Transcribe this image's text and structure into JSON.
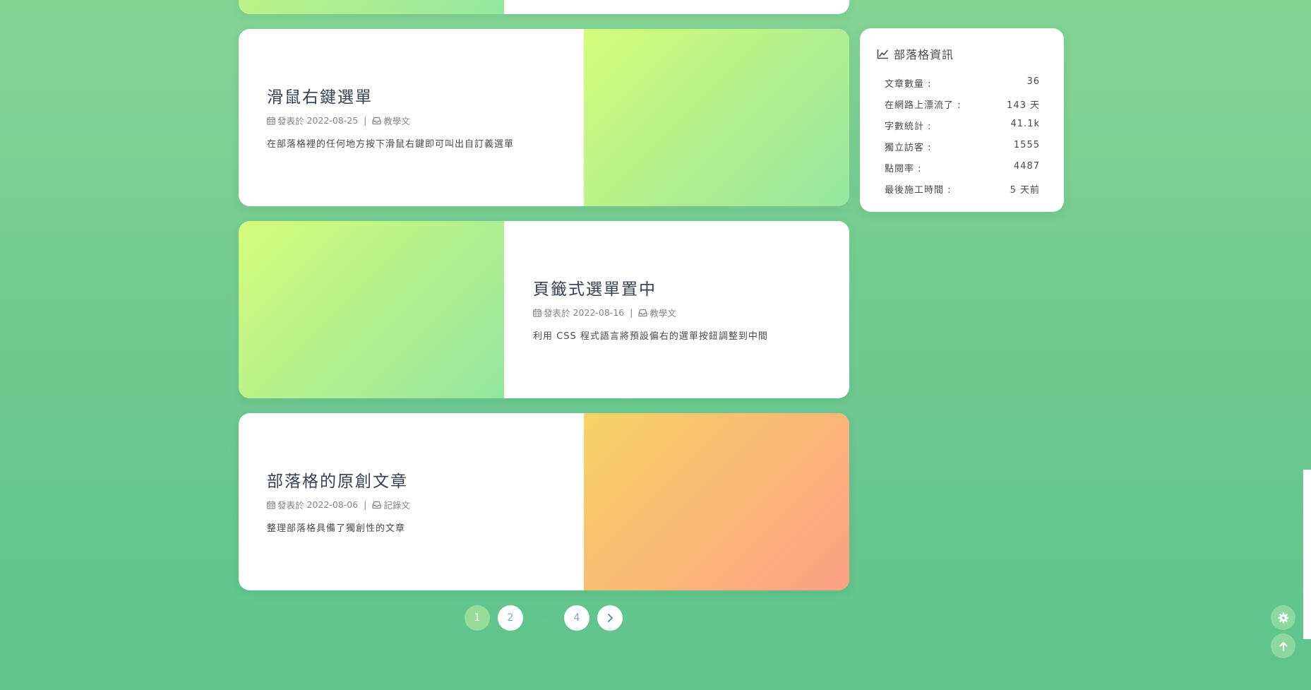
{
  "posts": [
    {
      "title": "滑鼠右鍵選單",
      "date_prefix": "發表於",
      "date": "2022-08-25",
      "category": "教學文",
      "description": "在部落格裡的任何地方按下滑鼠右鍵即可叫出自訂義選單"
    },
    {
      "title": "頁籤式選單置中",
      "date_prefix": "發表於",
      "date": "2022-08-16",
      "category": "教學文",
      "description": "利用 CSS 程式語言將預設偏右的選單按鈕調整到中間"
    },
    {
      "title": "部落格的原創文章",
      "date_prefix": "發表於",
      "date": "2022-08-06",
      "category": "記錄文",
      "description": "整理部落格具備了獨創性的文章"
    }
  ],
  "pagination": {
    "current": "1",
    "pages": [
      "2",
      "4"
    ],
    "ellipsis": "···"
  },
  "sidebar": {
    "widget_title": "部落格資訊",
    "stats": [
      {
        "label": "文章數量 :",
        "value": "36"
      },
      {
        "label": "在網路上漂流了 :",
        "value": "143 天"
      },
      {
        "label": "字數統計 :",
        "value": "41.1k"
      },
      {
        "label": "獨立訪客 :",
        "value": "1555"
      },
      {
        "label": "點閱率 :",
        "value": "4487"
      },
      {
        "label": "最後施工時間 :",
        "value": "5 天前"
      }
    ]
  },
  "colors": {
    "background": "#6cc890",
    "cover_green_start": "#d4fc79",
    "cover_green_end": "#96e6a1",
    "cover_orange_start": "#f6d365",
    "cover_orange_end": "#fda085",
    "pagination_current": "#98dc9a",
    "float_button": "#8bd9a0"
  },
  "icons": {
    "date": "calendar-icon",
    "category": "inbox-icon",
    "widget": "chart-line-icon",
    "next_page": "chevron-right-icon",
    "settings": "gear-icon",
    "back_to_top": "arrow-up-icon"
  }
}
